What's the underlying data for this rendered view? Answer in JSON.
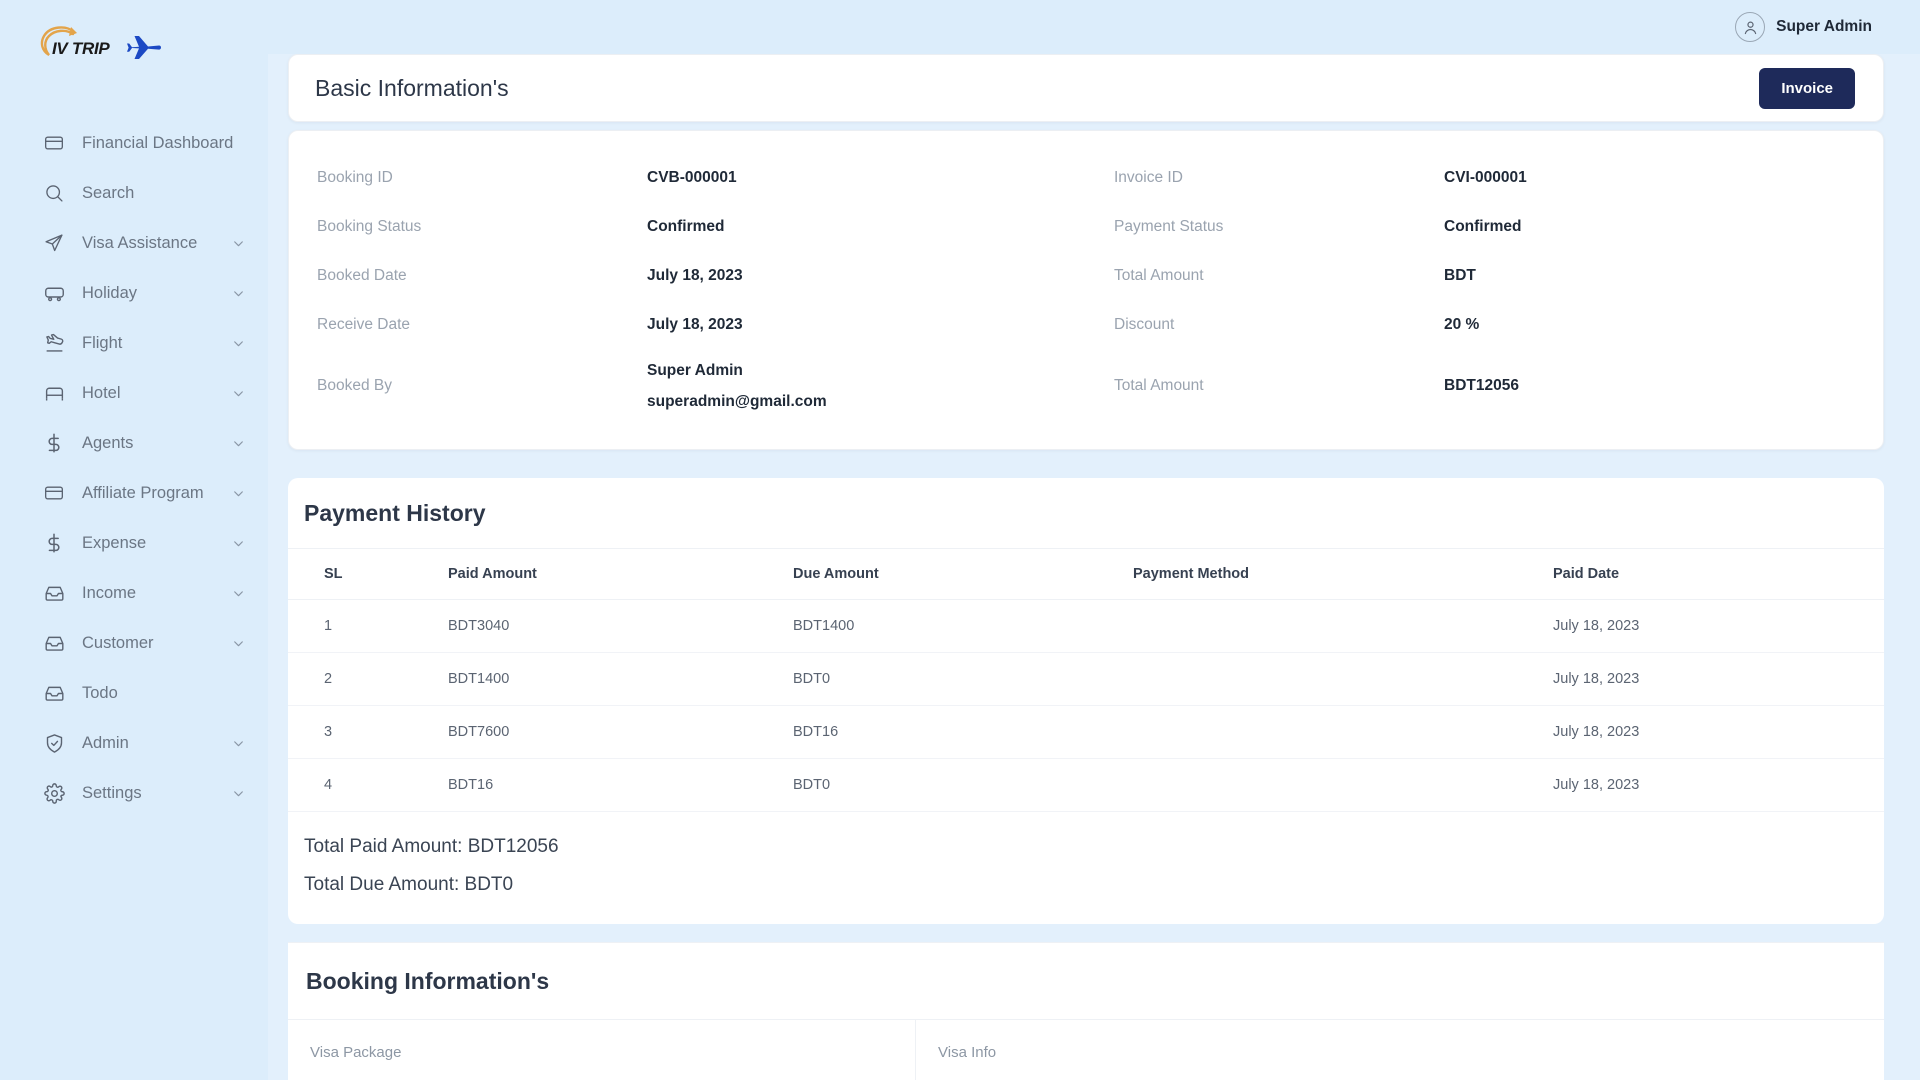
{
  "brand": {
    "name": "IV TRIP",
    "swoosh_icon": "swoosh-arrow-icon",
    "plane_icon": "airplane-icon"
  },
  "topbar": {
    "user_name": "Super Admin",
    "avatar_icon": "user-avatar-icon"
  },
  "sidebar": {
    "items": [
      {
        "label": "Financial Dashboard",
        "icon": "credit-card-icon",
        "chevron": false
      },
      {
        "label": "Search",
        "icon": "search-icon",
        "chevron": false
      },
      {
        "label": "Visa Assistance",
        "icon": "paper-plane-icon",
        "chevron": true
      },
      {
        "label": "Holiday",
        "icon": "bus-icon",
        "chevron": true
      },
      {
        "label": "Flight",
        "icon": "airplane-takeoff-icon",
        "chevron": true
      },
      {
        "label": "Hotel",
        "icon": "bed-icon",
        "chevron": true
      },
      {
        "label": "Agents",
        "icon": "dollar-icon",
        "chevron": true
      },
      {
        "label": "Affiliate Program",
        "icon": "credit-card-icon",
        "chevron": true
      },
      {
        "label": "Expense",
        "icon": "dollar-icon",
        "chevron": true
      },
      {
        "label": "Income",
        "icon": "inbox-icon",
        "chevron": true
      },
      {
        "label": "Customer",
        "icon": "inbox-icon",
        "chevron": true
      },
      {
        "label": "Todo",
        "icon": "inbox-icon",
        "chevron": false
      },
      {
        "label": "Admin",
        "icon": "shield-check-icon",
        "chevron": true
      },
      {
        "label": "Settings",
        "icon": "gear-icon",
        "chevron": true
      }
    ]
  },
  "basic_information": {
    "title": "Basic Information's",
    "invoice_button": "Invoice",
    "left_rows": [
      {
        "label": "Booking ID",
        "value": "CVB-000001"
      },
      {
        "label": "Booking Status",
        "value": "Confirmed"
      },
      {
        "label": "Booked Date",
        "value": "July 18, 2023"
      },
      {
        "label": "Receive Date",
        "value": "July 18, 2023"
      },
      {
        "label": "Booked By",
        "value": "Super Admin",
        "value_sub": "superadmin@gmail.com"
      }
    ],
    "right_rows": [
      {
        "label": "Invoice ID",
        "value": "CVI-000001"
      },
      {
        "label": "Payment Status",
        "value": "Confirmed"
      },
      {
        "label": "Total Amount",
        "value": "BDT"
      },
      {
        "label": "Discount",
        "value": "20 %"
      },
      {
        "label": "Total Amount",
        "value": "BDT12056"
      }
    ]
  },
  "payment_history": {
    "title": "Payment History",
    "columns": [
      "SL",
      "Paid Amount",
      "Due Amount",
      "Payment Method",
      "Paid Date"
    ],
    "rows": [
      {
        "sl": "1",
        "paid": "BDT3040",
        "due": "BDT1400",
        "method": "",
        "date": "July 18, 2023"
      },
      {
        "sl": "2",
        "paid": "BDT1400",
        "due": "BDT0",
        "method": "",
        "date": "July 18, 2023"
      },
      {
        "sl": "3",
        "paid": "BDT7600",
        "due": "BDT16",
        "method": "",
        "date": "July 18, 2023"
      },
      {
        "sl": "4",
        "paid": "BDT16",
        "due": "BDT0",
        "method": "",
        "date": "July 18, 2023"
      }
    ],
    "total_paid": "Total Paid Amount: BDT12056",
    "total_due": "Total Due Amount: BDT0"
  },
  "booking_information": {
    "title": "Booking Information's",
    "col_visa_package": "Visa Package",
    "col_visa_info": "Visa Info"
  },
  "colors": {
    "sidebar_bg": "#dcedfb",
    "page_bg": "#e3f0fc",
    "accent_dark": "#1e2a5a",
    "brand_orange": "#e3a44a",
    "brand_blue": "#1c49c4",
    "muted_text": "#9aa3af"
  }
}
